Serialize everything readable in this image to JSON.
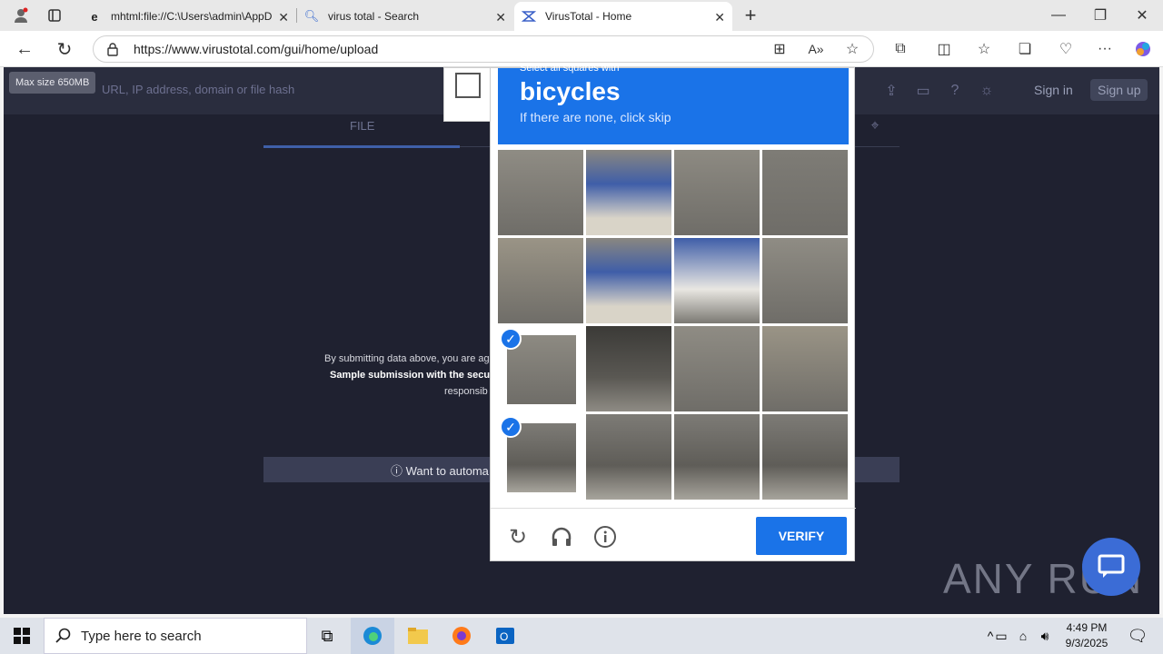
{
  "browser": {
    "tabs": [
      {
        "title": "mhtml:file://C:\\Users\\admin\\AppD",
        "icon": "ie-icon"
      },
      {
        "title": "virus total - Search",
        "icon": "search-icon"
      },
      {
        "title": "VirusTotal - Home",
        "icon": "virustotal-icon"
      }
    ],
    "url": "https://www.virustotal.com/gui/home/upload"
  },
  "page": {
    "max_size": "Max size 650MB",
    "search_placeholder": "URL, IP address, domain or file hash",
    "sign_in": "Sign in",
    "sign_up": "Sign up",
    "file_tab": "FILE",
    "terms_line1": "By submitting data above, you are ag",
    "terms_line2": "Sample submission with the secu",
    "terms_line3": "responsib",
    "want_automate": "ⓘ Want to automa",
    "watermark": "ANY RUN"
  },
  "captcha": {
    "prompt_small": "Select all squares with",
    "object": "bicycles",
    "hint": "If there are none, click skip",
    "verify_label": "VERIFY",
    "selected_tiles": [
      8,
      12
    ]
  },
  "taskbar": {
    "search_placeholder": "Type here to search",
    "time": "4:49 PM",
    "date": "9/3/2025"
  }
}
